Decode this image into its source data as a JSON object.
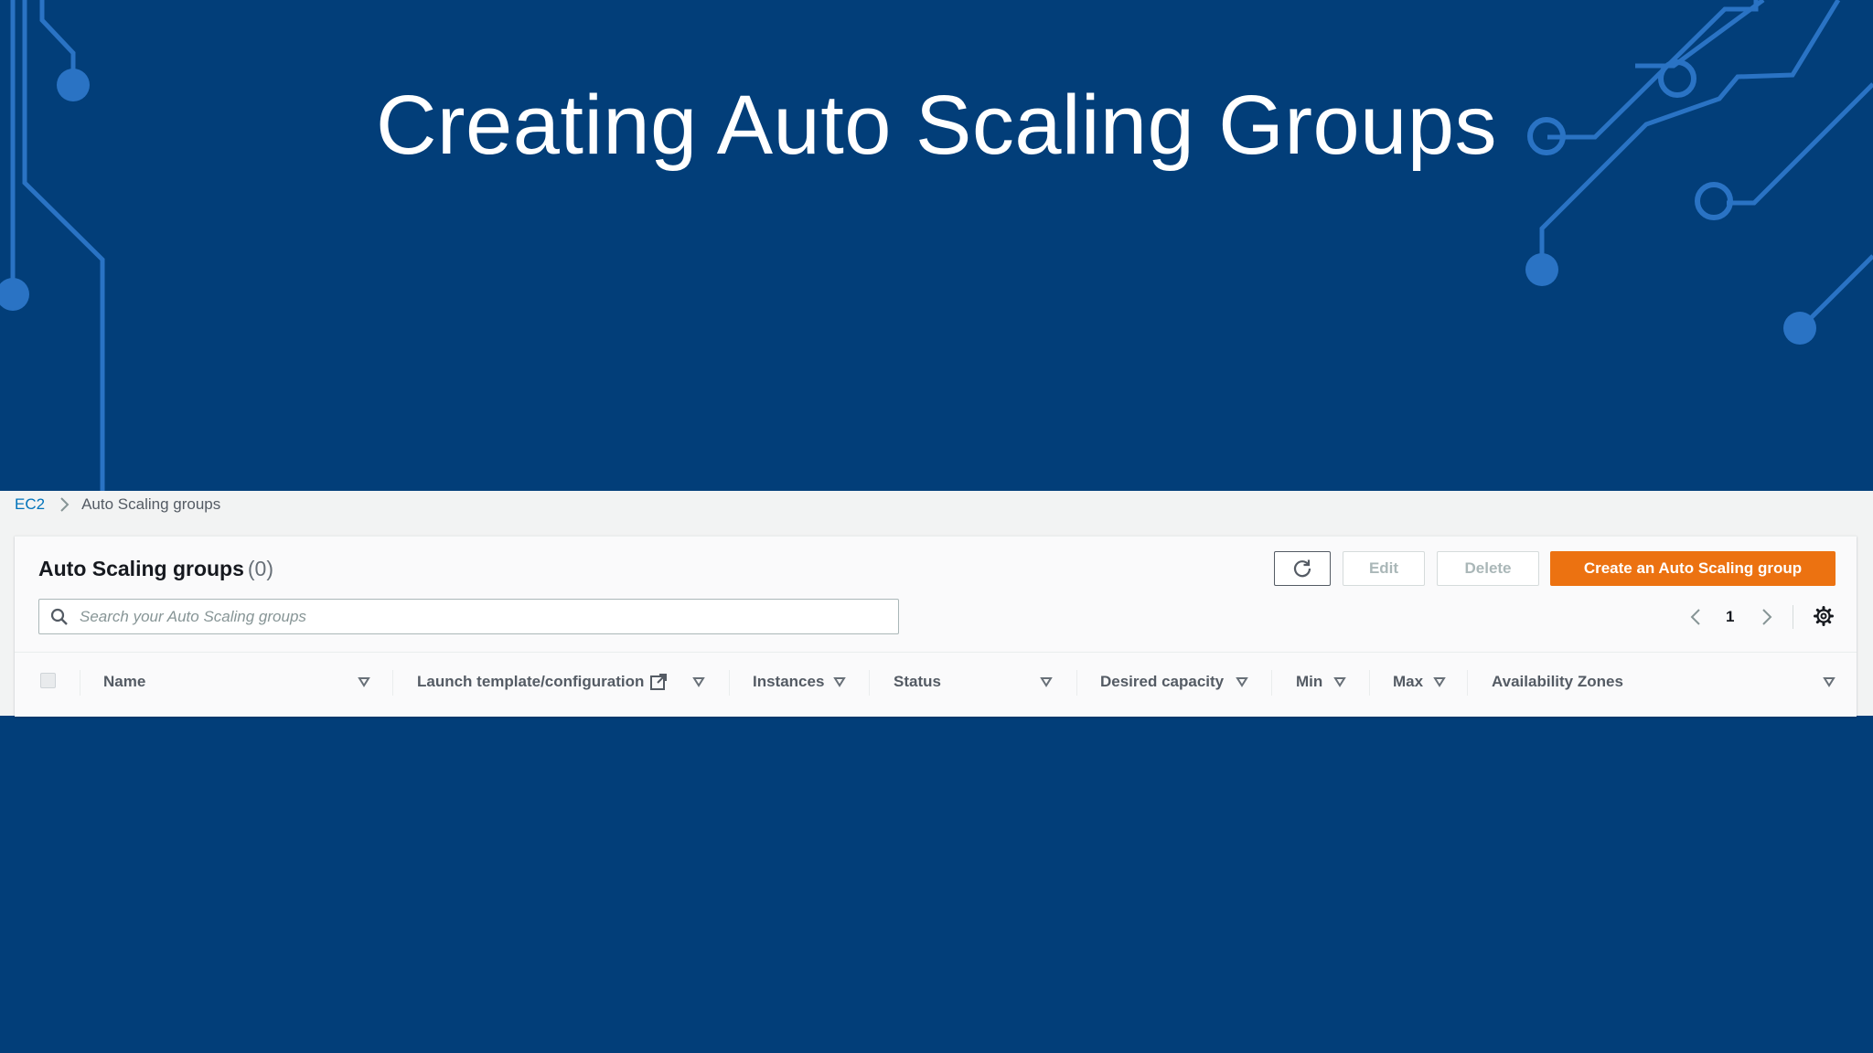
{
  "slide": {
    "title": "Creating Auto Scaling Groups"
  },
  "colors": {
    "background": "#023e79",
    "circuit": "#2a73c4",
    "primary_button": "#ec7211",
    "link": "#0073bb"
  },
  "breadcrumb": {
    "root": "EC2",
    "current": "Auto Scaling groups",
    "separator_icon": "chevron-right-icon"
  },
  "panel": {
    "title": "Auto Scaling groups",
    "count": "(0)",
    "buttons": {
      "refresh_icon": "refresh-icon",
      "edit": "Edit",
      "delete": "Delete",
      "create": "Create an Auto Scaling group"
    }
  },
  "search": {
    "placeholder": "Search your Auto Scaling groups",
    "value": ""
  },
  "pagination": {
    "current_page": "1"
  },
  "table": {
    "columns": [
      {
        "label": "Name"
      },
      {
        "label": "Launch template/configuration",
        "icon": "external-link-icon"
      },
      {
        "label": "Instances"
      },
      {
        "label": "Status"
      },
      {
        "label": "Desired capacity"
      },
      {
        "label": "Min"
      },
      {
        "label": "Max"
      },
      {
        "label": "Availability Zones"
      }
    ],
    "rows": []
  }
}
